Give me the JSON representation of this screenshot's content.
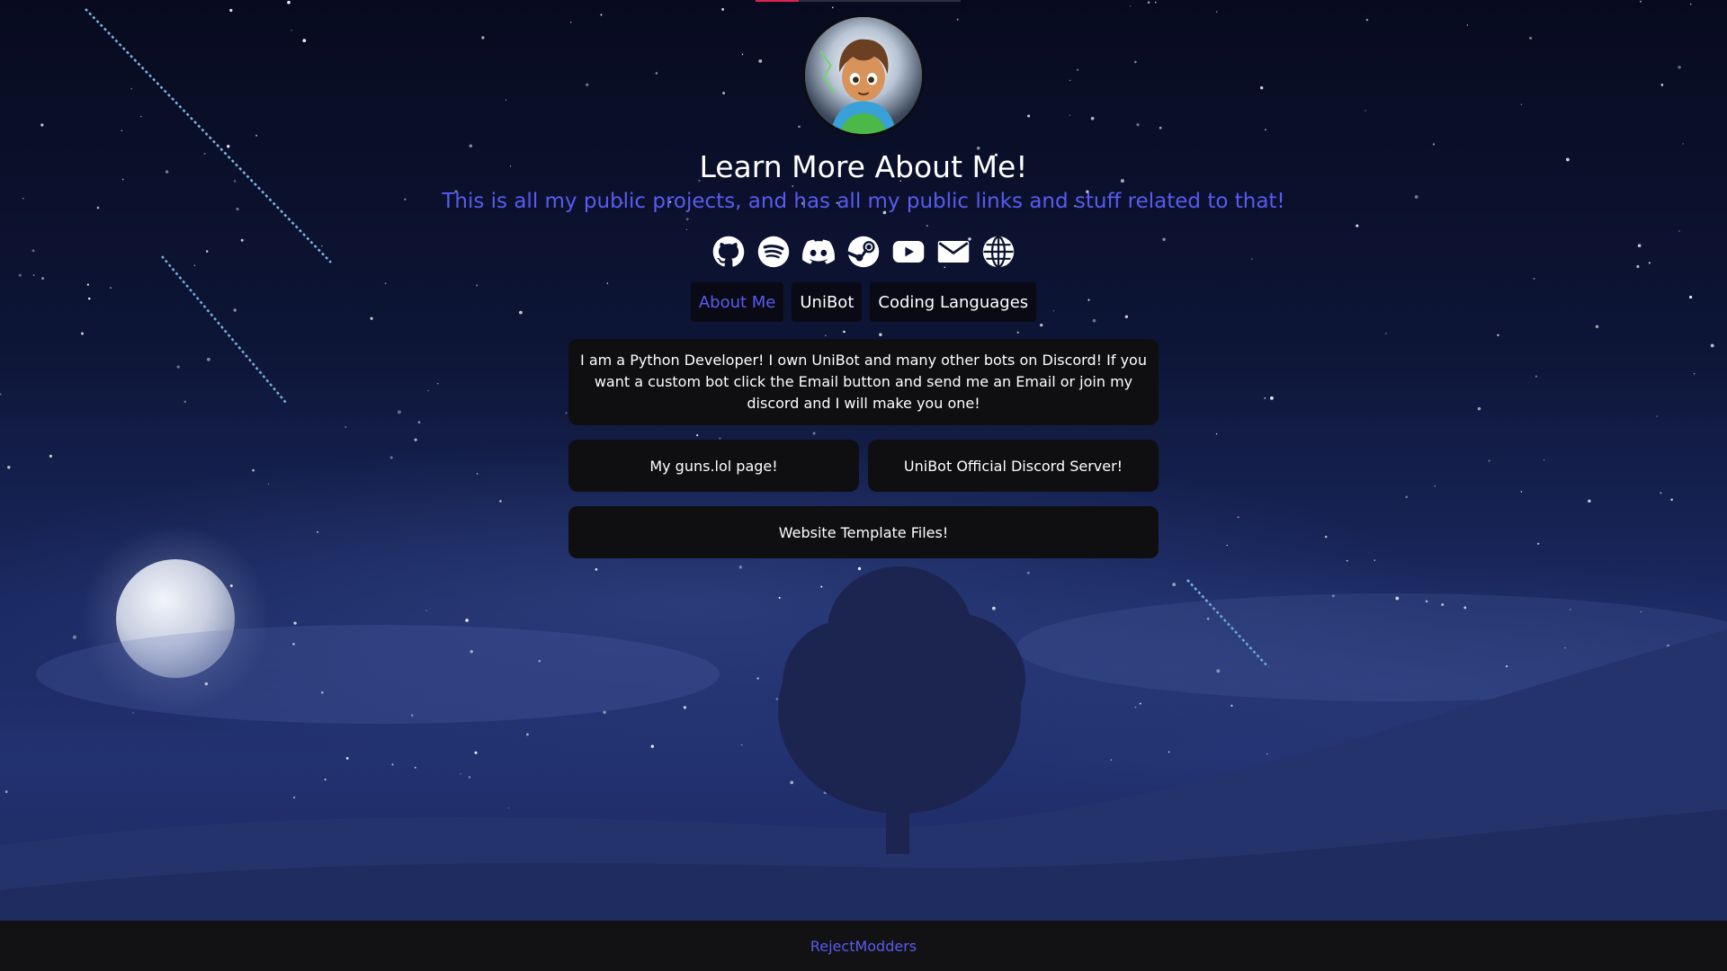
{
  "profile": {
    "title": "Learn More About Me!",
    "subtitle": "This is all my public projects, and has all my public links and stuff related to that!"
  },
  "socials": [
    {
      "icon": "github-icon"
    },
    {
      "icon": "spotify-icon"
    },
    {
      "icon": "discord-icon"
    },
    {
      "icon": "steam-icon"
    },
    {
      "icon": "youtube-icon"
    },
    {
      "icon": "email-icon"
    },
    {
      "icon": "globe-icon"
    }
  ],
  "tabs": {
    "about": "About Me",
    "unibot": "UniBot",
    "languages": "Coding Languages",
    "active": "about"
  },
  "about": {
    "text": "I am a Python Developer! I own UniBot and many other bots on Discord! If you want a custom bot click the Email button and send me an Email or join my discord and I will make you one!"
  },
  "buttons": {
    "guns": "My guns.lol page!",
    "discord_server": "UniBot Official Discord Server!",
    "template": "Website Template Files!"
  },
  "footer": {
    "link": "RejectModders"
  },
  "colors": {
    "accent": "#5a5af0",
    "card": "#0f0f12",
    "footer": "#121214",
    "top_accent": "#e0234e"
  }
}
